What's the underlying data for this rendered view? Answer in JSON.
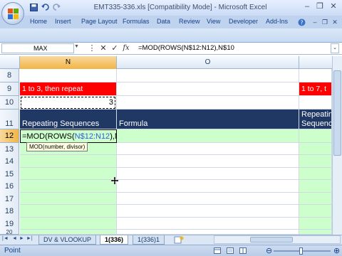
{
  "window": {
    "title": "EMT335-336.xls  [Compatibility Mode] - Microsoft Excel",
    "minimize": "–",
    "restore": "❐",
    "close": "✕"
  },
  "ribbon": {
    "tabs": [
      "Home",
      "Insert",
      "Page Layout",
      "Formulas",
      "Data",
      "Review",
      "View",
      "Developer",
      "Add-Ins"
    ]
  },
  "formula_bar": {
    "name_box": "MAX",
    "cancel": "✕",
    "enter": "✓",
    "fx": "fx",
    "formula": "=MOD(ROWS(N$12:N12),N$10"
  },
  "grid": {
    "columns": [
      "N",
      "O"
    ],
    "active_column": "N",
    "rows": [
      "8",
      "9",
      "10",
      "11",
      "12",
      "13",
      "14",
      "15",
      "16",
      "17",
      "18",
      "19",
      "20"
    ],
    "active_row": "12",
    "cells": {
      "n9": "1 to 3, then repeat",
      "n10": "3",
      "n11": "Repeating Sequences",
      "o11": "Formula",
      "right_9": "1 to 7, t",
      "right_11a": "Repeatin",
      "right_11b": "Sequenc"
    },
    "edit_cell": {
      "part1": "=MOD(ROWS(",
      "ref": "N$12:N12",
      "part2": "),N$10"
    },
    "tooltip": "MOD(number, divisor)"
  },
  "sheets": {
    "tabs": [
      "DV & VLOOKUP",
      "1(336)",
      "1(336)1"
    ],
    "active": "1(336)"
  },
  "status": {
    "mode": "Point"
  },
  "colors": {
    "red_banner": "#ff0000",
    "header_navy": "#1f3864",
    "green_fill": "#ccffcc",
    "excel_blue": "#15428b"
  }
}
